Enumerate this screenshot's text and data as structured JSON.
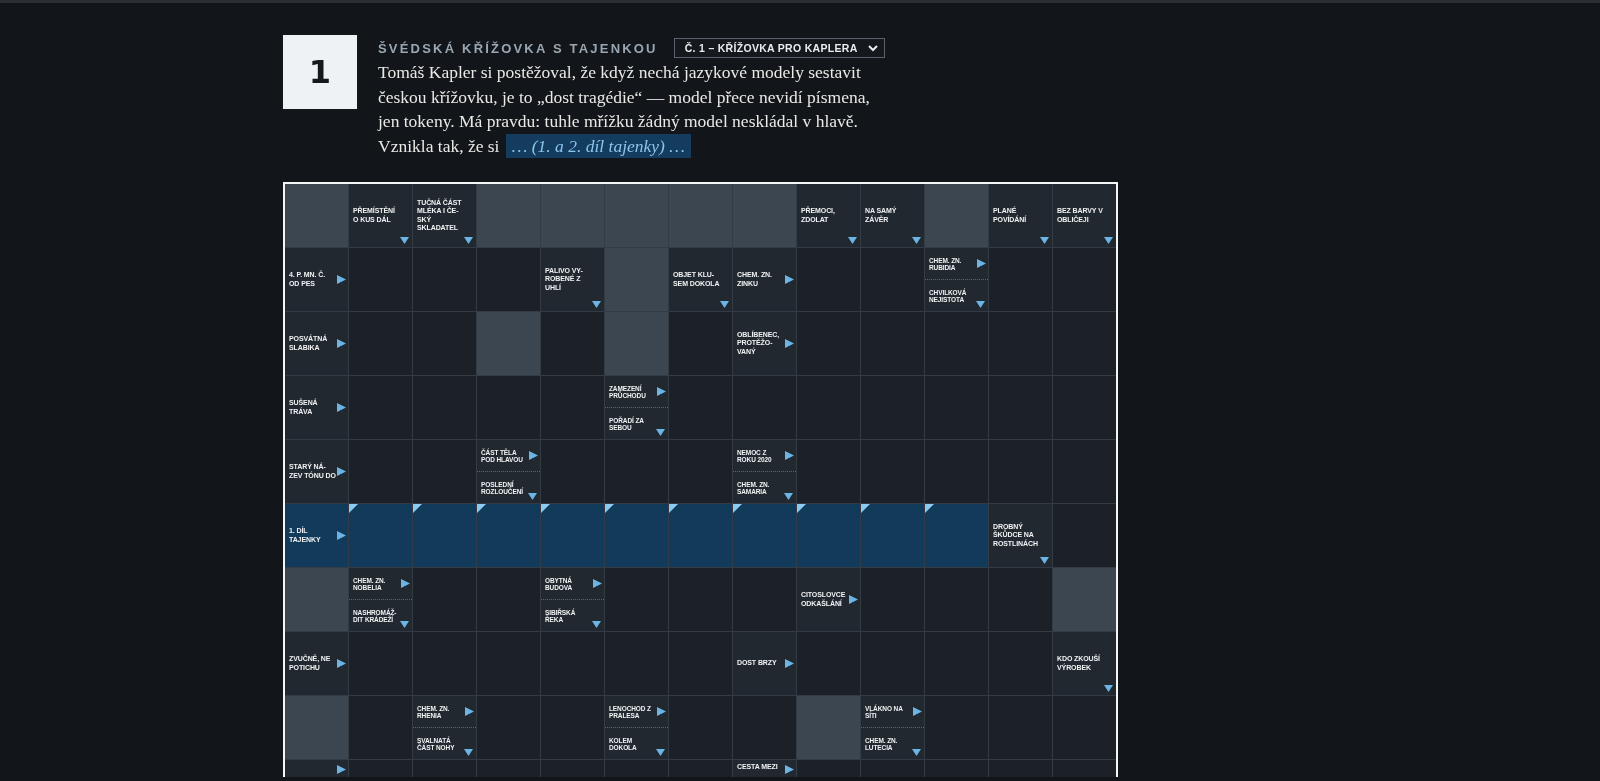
{
  "puzzle": {
    "number": "1",
    "title": "ŠVÉDSKÁ KŘÍŽOVKA S TAJENKOU",
    "select": "Č. 1 – KŘÍŽOVKA PRO KAPLERA",
    "intro": "Tomáš Kapler si postěžoval, že když nechá jazykové modely sestavit českou křížovku, je to „dost tragédie“ — model přece nevidí písmena, jen tokeny. Má pravdu: tuhle mřížku žádný model neskládal v hlavě. Vznikla tak, že si ",
    "blank": "… (1. a 2. díl tajenky) …"
  },
  "grid": {
    "rows": [
      {
        "cells": [
          {
            "kind": "block"
          },
          {
            "kind": "clue",
            "clues": [
              {
                "kind": "down",
                "text": "PŘEMÍSTĚNÍ O KUS DÁL"
              }
            ]
          },
          {
            "kind": "clue",
            "clues": [
              {
                "kind": "down",
                "text": "TUČNÁ ČÁST MLÉKA I ČE-SKÝ SKLADATEL"
              }
            ]
          },
          {
            "kind": "block"
          },
          {
            "kind": "block"
          },
          {
            "kind": "block"
          },
          {
            "kind": "block"
          },
          {
            "kind": "block"
          },
          {
            "kind": "clue",
            "clues": [
              {
                "kind": "down",
                "text": "PŘEMOCI, ZDOLAT"
              }
            ]
          },
          {
            "kind": "clue",
            "clues": [
              {
                "kind": "down",
                "text": "NA SAMÝ ZÁVĚR"
              }
            ]
          },
          {
            "kind": "block"
          },
          {
            "kind": "clue",
            "clues": [
              {
                "kind": "down",
                "text": "PLANÉ POVÍDÁNÍ"
              }
            ]
          },
          {
            "kind": "clue",
            "clues": [
              {
                "kind": "down",
                "text": "BEZ BARVY V OBLIČEJI"
              }
            ]
          }
        ]
      },
      {
        "cells": [
          {
            "kind": "clue",
            "clues": [
              {
                "kind": "right",
                "text": "4. P. MN. Č. OD PES"
              }
            ]
          },
          {
            "kind": "empty"
          },
          {
            "kind": "empty"
          },
          {
            "kind": "empty"
          },
          {
            "kind": "clue",
            "clues": [
              {
                "kind": "down",
                "text": "PALIVO VY-ROBENÉ Z UHLÍ"
              }
            ]
          },
          {
            "kind": "block"
          },
          {
            "kind": "clue",
            "clues": [
              {
                "kind": "down",
                "text": "OBJET KLU-SEM DOKOLA"
              }
            ]
          },
          {
            "kind": "clue",
            "clues": [
              {
                "kind": "right",
                "text": "CHEM. ZN. ZINKU"
              }
            ]
          },
          {
            "kind": "empty"
          },
          {
            "kind": "empty"
          },
          {
            "kind": "clue",
            "clues": [
              {
                "kind": "right",
                "text": "CHEM. ZN. RUBIDIA"
              },
              {
                "kind": "down",
                "text": "CHVILKOVÁ NEJISTOTA"
              }
            ]
          },
          {
            "kind": "empty"
          },
          {
            "kind": "empty"
          }
        ]
      },
      {
        "cells": [
          {
            "kind": "clue",
            "clues": [
              {
                "kind": "right",
                "text": "POSVÁTNÁ SLABIKA"
              }
            ]
          },
          {
            "kind": "empty"
          },
          {
            "kind": "empty"
          },
          {
            "kind": "block"
          },
          {
            "kind": "empty"
          },
          {
            "kind": "block"
          },
          {
            "kind": "empty"
          },
          {
            "kind": "clue",
            "clues": [
              {
                "kind": "right",
                "text": "OBLÍBENEC, PROTĚŽO-VANÝ"
              }
            ]
          },
          {
            "kind": "empty"
          },
          {
            "kind": "empty"
          },
          {
            "kind": "empty"
          },
          {
            "kind": "empty"
          },
          {
            "kind": "empty"
          }
        ]
      },
      {
        "cells": [
          {
            "kind": "clue",
            "clues": [
              {
                "kind": "right",
                "text": "SUŠENÁ TRÁVA"
              }
            ]
          },
          {
            "kind": "empty"
          },
          {
            "kind": "empty"
          },
          {
            "kind": "empty"
          },
          {
            "kind": "empty"
          },
          {
            "kind": "clue",
            "clues": [
              {
                "kind": "right",
                "text": "ZAMEZENÍ PRŮCHODU"
              },
              {
                "kind": "down",
                "text": "POŘADÍ ZA SEBOU"
              }
            ]
          },
          {
            "kind": "empty"
          },
          {
            "kind": "empty"
          },
          {
            "kind": "empty"
          },
          {
            "kind": "empty"
          },
          {
            "kind": "empty"
          },
          {
            "kind": "empty"
          },
          {
            "kind": "empty"
          }
        ]
      },
      {
        "cells": [
          {
            "kind": "clue",
            "clues": [
              {
                "kind": "right",
                "text": "STARÝ NÁ-ZEV TÓNU DO"
              }
            ]
          },
          {
            "kind": "empty"
          },
          {
            "kind": "empty"
          },
          {
            "kind": "clue",
            "clues": [
              {
                "kind": "right",
                "text": "ČÁST TĚLA POD HLAVOU"
              },
              {
                "kind": "down",
                "text": "POSLEDNÍ ROZLOUČENÍ"
              }
            ]
          },
          {
            "kind": "empty"
          },
          {
            "kind": "empty"
          },
          {
            "kind": "empty"
          },
          {
            "kind": "clue",
            "clues": [
              {
                "kind": "right",
                "text": "NEMOC Z ROKU 2020"
              },
              {
                "kind": "down",
                "text": "CHEM. ZN. SAMARIA"
              }
            ]
          },
          {
            "kind": "empty"
          },
          {
            "kind": "empty"
          },
          {
            "kind": "empty"
          },
          {
            "kind": "empty"
          },
          {
            "kind": "empty"
          }
        ]
      },
      {
        "cells": [
          {
            "kind": "secret_clue",
            "clues": [
              {
                "kind": "right",
                "text": "1. DÍL TAJENKY"
              }
            ]
          },
          {
            "kind": "secret"
          },
          {
            "kind": "secret"
          },
          {
            "kind": "secret"
          },
          {
            "kind": "secret"
          },
          {
            "kind": "secret"
          },
          {
            "kind": "secret"
          },
          {
            "kind": "secret"
          },
          {
            "kind": "secret"
          },
          {
            "kind": "secret"
          },
          {
            "kind": "secret"
          },
          {
            "kind": "clue",
            "clues": [
              {
                "kind": "down",
                "text": "DROBNÝ ŠKŮDCE NA ROSTLINÁCH"
              }
            ]
          },
          {
            "kind": "empty"
          }
        ]
      },
      {
        "cells": [
          {
            "kind": "block"
          },
          {
            "kind": "clue",
            "clues": [
              {
                "kind": "right",
                "text": "CHEM. ZN. NOBELIA"
              },
              {
                "kind": "down",
                "text": "NASHROMÁŽ-DIT KRÁDEŽÍ"
              }
            ]
          },
          {
            "kind": "empty"
          },
          {
            "kind": "empty"
          },
          {
            "kind": "clue",
            "clues": [
              {
                "kind": "right",
                "text": "OBYTNÁ BUDOVA"
              },
              {
                "kind": "down",
                "text": "SIBIŘSKÁ ŘEKA"
              }
            ]
          },
          {
            "kind": "empty"
          },
          {
            "kind": "empty"
          },
          {
            "kind": "empty"
          },
          {
            "kind": "clue",
            "clues": [
              {
                "kind": "right",
                "text": "CITOSLOVCE ODKAŠLÁNÍ"
              }
            ]
          },
          {
            "kind": "empty"
          },
          {
            "kind": "empty"
          },
          {
            "kind": "empty"
          },
          {
            "kind": "block"
          }
        ]
      },
      {
        "cells": [
          {
            "kind": "clue",
            "clues": [
              {
                "kind": "right",
                "text": "ZVUČNĚ, NE POTICHU"
              }
            ]
          },
          {
            "kind": "empty"
          },
          {
            "kind": "empty"
          },
          {
            "kind": "empty"
          },
          {
            "kind": "empty"
          },
          {
            "kind": "empty"
          },
          {
            "kind": "empty"
          },
          {
            "kind": "clue",
            "clues": [
              {
                "kind": "right",
                "text": "DOST BRZY"
              }
            ]
          },
          {
            "kind": "empty"
          },
          {
            "kind": "empty"
          },
          {
            "kind": "empty"
          },
          {
            "kind": "empty"
          },
          {
            "kind": "clue",
            "clues": [
              {
                "kind": "down",
                "text": "KDO ZKOUŠÍ VÝROBEK"
              }
            ]
          }
        ]
      },
      {
        "cells": [
          {
            "kind": "block"
          },
          {
            "kind": "empty"
          },
          {
            "kind": "clue",
            "clues": [
              {
                "kind": "right",
                "text": "CHEM. ZN. RHENIA"
              },
              {
                "kind": "down",
                "text": "SVALNATÁ ČÁST NOHY"
              }
            ]
          },
          {
            "kind": "empty"
          },
          {
            "kind": "empty"
          },
          {
            "kind": "clue",
            "clues": [
              {
                "kind": "right",
                "text": "LENOCHOD Z PRALESA"
              },
              {
                "kind": "down",
                "text": "KOLEM DOKOLA"
              }
            ]
          },
          {
            "kind": "empty"
          },
          {
            "kind": "empty"
          },
          {
            "kind": "block"
          },
          {
            "kind": "clue",
            "clues": [
              {
                "kind": "right",
                "text": "VLÁKNO NA SÍTI"
              },
              {
                "kind": "down",
                "text": "CHEM. ZN. LUTECIA"
              }
            ]
          },
          {
            "kind": "empty"
          },
          {
            "kind": "empty"
          },
          {
            "kind": "empty"
          }
        ]
      },
      {
        "cells": [
          {
            "kind": "clue",
            "clues": [
              {
                "kind": "right"
              }
            ]
          },
          {
            "kind": "empty"
          },
          {
            "kind": "empty"
          },
          {
            "kind": "empty"
          },
          {
            "kind": "empty"
          },
          {
            "kind": "empty"
          },
          {
            "kind": "empty"
          },
          {
            "kind": "clue",
            "clues": [
              {
                "kind": "right",
                "text": "CESTA MEZI"
              }
            ]
          },
          {
            "kind": "empty"
          },
          {
            "kind": "empty"
          },
          {
            "kind": "empty"
          },
          {
            "kind": "empty"
          },
          {
            "kind": "empty"
          }
        ]
      }
    ]
  }
}
